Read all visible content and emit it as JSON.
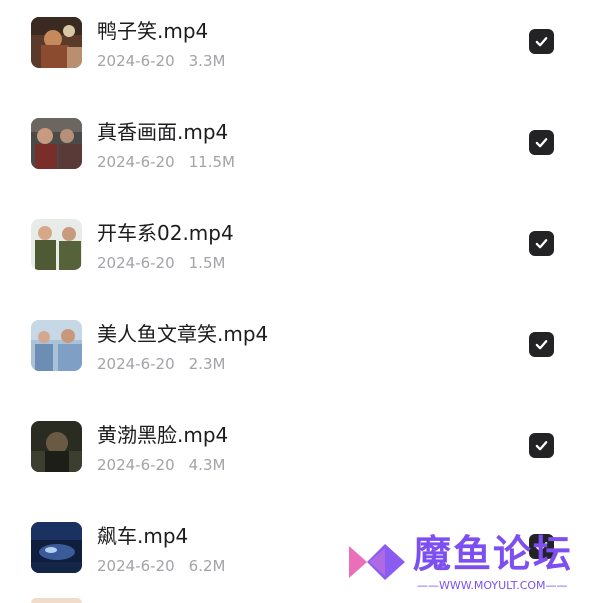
{
  "files": [
    {
      "name": "鸭子笑.mp4",
      "date": "2024-6-20",
      "size": "3.3M",
      "checked": true
    },
    {
      "name": "真香画面.mp4",
      "date": "2024-6-20",
      "size": "11.5M",
      "checked": true
    },
    {
      "name": "开车系02.mp4",
      "date": "2024-6-20",
      "size": "1.5M",
      "checked": true
    },
    {
      "name": "美人鱼文章笑.mp4",
      "date": "2024-6-20",
      "size": "2.3M",
      "checked": true
    },
    {
      "name": "黄渤黑脸.mp4",
      "date": "2024-6-20",
      "size": "4.3M",
      "checked": true
    },
    {
      "name": "飙车.mp4",
      "date": "2024-6-20",
      "size": "6.2M",
      "checked": true
    }
  ],
  "watermark": {
    "title": "魔鱼论坛",
    "url": "WWW.MOYULT.COM"
  },
  "colors": {
    "checkbox": "#232325",
    "meta_text": "#a3a3a8",
    "watermark": "#7d4ff0"
  }
}
